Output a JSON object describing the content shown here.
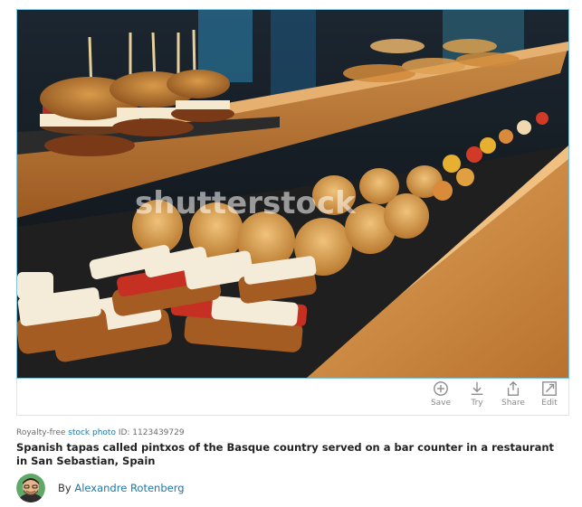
{
  "photo": {
    "watermark": "shutterstock",
    "alt": "Spanish tapas called pintxos of the Basque country served on a bar counter in a restaurant in San Sebastian, Spain"
  },
  "actions": [
    {
      "label": "Save",
      "icon": "plus-circle-icon"
    },
    {
      "label": "Try",
      "icon": "download-icon"
    },
    {
      "label": "Share",
      "icon": "share-icon"
    },
    {
      "label": "Edit",
      "icon": "edit-icon"
    }
  ],
  "meta": {
    "prefix": "Royalty-free ",
    "link": "stock photo",
    "id_text": " ID: 1123439729"
  },
  "title": "Spanish tapas called pintxos of the Basque country served on a bar counter in a restaurant in San Sebastian, Spain",
  "author": {
    "by": "By ",
    "name": "Alexandre Rotenberg"
  },
  "colors": {
    "link": "#1c76a8",
    "outline": "#7fc4de"
  }
}
